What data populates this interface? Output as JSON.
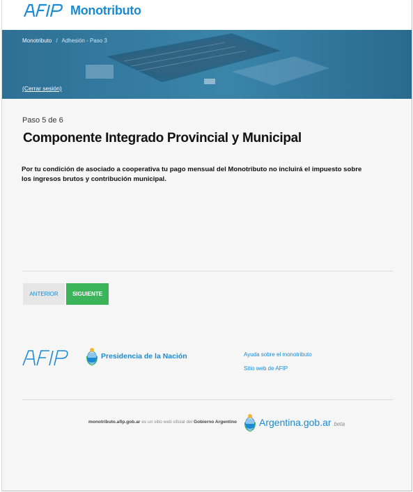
{
  "header": {
    "brand_logo": "AFIP",
    "brand_name": "Monotributo"
  },
  "hero": {
    "breadcrumb": {
      "root": "Monotributo",
      "separator": "/",
      "current": "Adhesión - Paso 3"
    },
    "logout_label": "(Cerrar sesión)"
  },
  "main": {
    "step_indicator": "Paso 5 de 6",
    "title": "Componente Integrado Provincial y Municipal",
    "message": "Por tu condición de asociado a cooperativa tu pago mensual del Monotributo no incluirá el impuesto sobre los ingresos brutos y contribución municipal.",
    "buttons": {
      "previous": "ANTERIOR",
      "next": "SIGUIENTE"
    }
  },
  "footer": {
    "afip_logo": "AFIP",
    "presidencia": "Presidencia de la Nación",
    "links": [
      "Ayuda sobre el monotributo",
      "Sitio web de AFIP"
    ],
    "official_site": {
      "domain": "monotributo.afip.gob.ar",
      "text": "es un sitio web oficial del",
      "entity": "Gobierno Argentino"
    },
    "argentina_gob": {
      "name": "Argentina.gob.ar",
      "badge": "beta"
    }
  },
  "colors": {
    "brand_blue": "#1a8ad2",
    "hero_blue": "#2f6f94",
    "next_green": "#3cb55a",
    "prev_gray": "#e6e6e6",
    "page_bg": "#f6f6f6"
  }
}
